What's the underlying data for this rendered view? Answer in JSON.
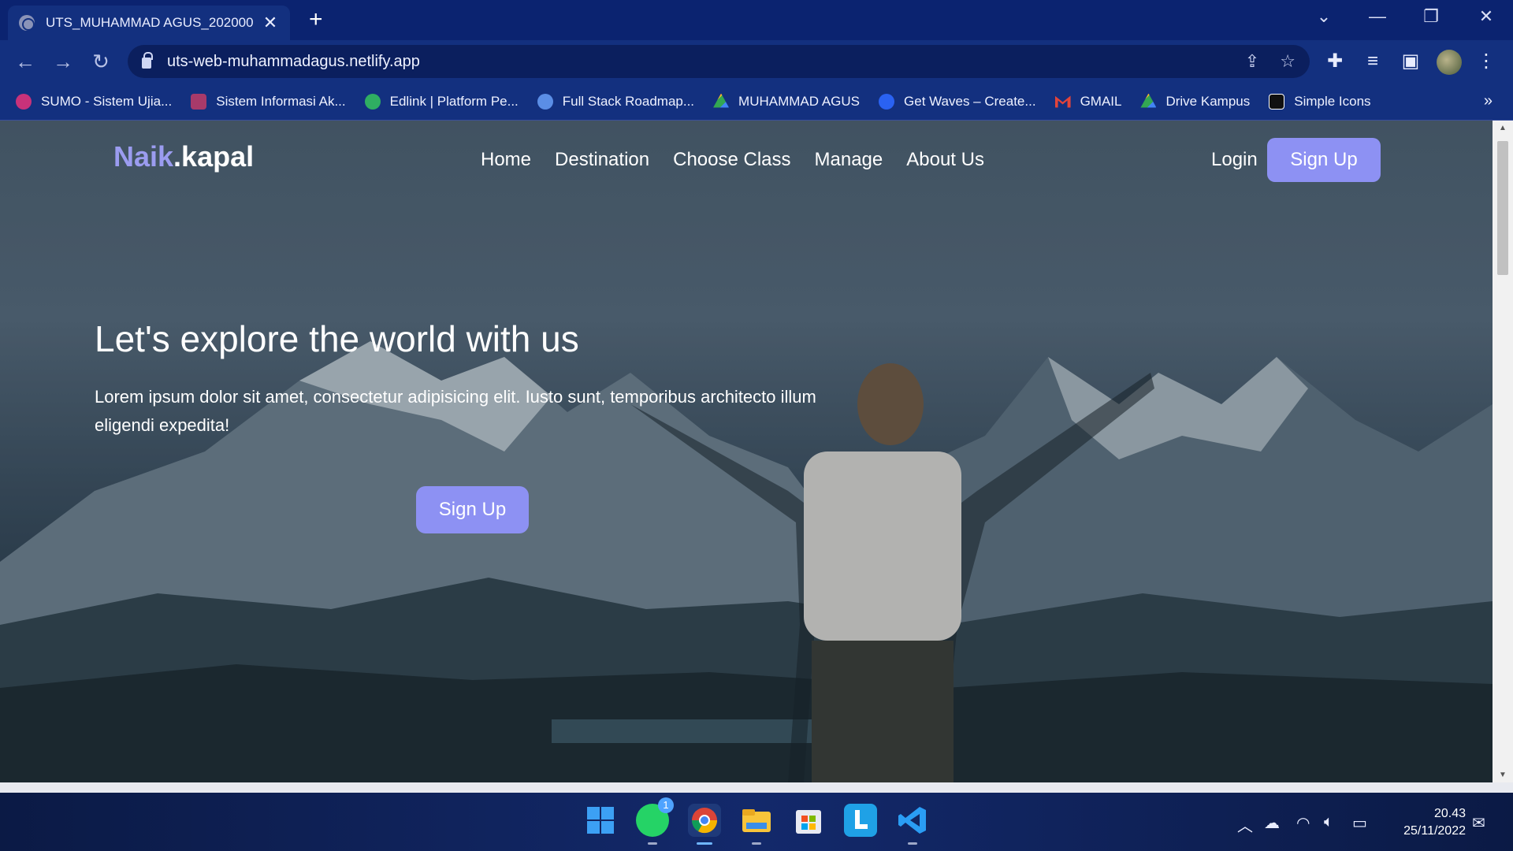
{
  "browser": {
    "tab_title": "UTS_MUHAMMAD AGUS_202000",
    "tab_close": "✕",
    "new_tab": "+",
    "url": "uts-web-muhammadagus.netlify.app",
    "bookmarks": [
      {
        "label": "SUMO - Sistem Ujia...",
        "color": "#c8327a"
      },
      {
        "label": "Sistem Informasi Ak...",
        "color": "#a83a6a"
      },
      {
        "label": "Edlink | Platform Pe...",
        "color": "#2fae62"
      },
      {
        "label": "Full Stack Roadmap...",
        "color": "#5b8ee6"
      },
      {
        "label": "MUHAMMAD AGUS",
        "color": "#f3b52a"
      },
      {
        "label": "Get Waves – Create...",
        "color": "#2a62f2"
      },
      {
        "label": "GMAIL",
        "color": "#e3443a"
      },
      {
        "label": "Drive Kampus",
        "color": "#33a852"
      },
      {
        "label": "Simple Icons",
        "color": "#111111"
      }
    ],
    "bookmarks_more": "»"
  },
  "site": {
    "logo_accent": "Naik",
    "logo_rest": ".kapal",
    "nav": [
      "Home",
      "Destination",
      "Choose Class",
      "Manage",
      "About Us"
    ],
    "login": "Login",
    "signup": "Sign Up",
    "hero_title": "Let's explore the world with us",
    "hero_text": "Lorem ipsum dolor sit amet, consectetur adipisicing elit. Iusto sunt, temporibus architecto illum eligendi expedita!",
    "hero_button": "Sign Up",
    "accent_color": "#8d91f3"
  },
  "taskbar": {
    "whatsapp_badge": "1",
    "time": "20.43",
    "date": "25/11/2022"
  }
}
